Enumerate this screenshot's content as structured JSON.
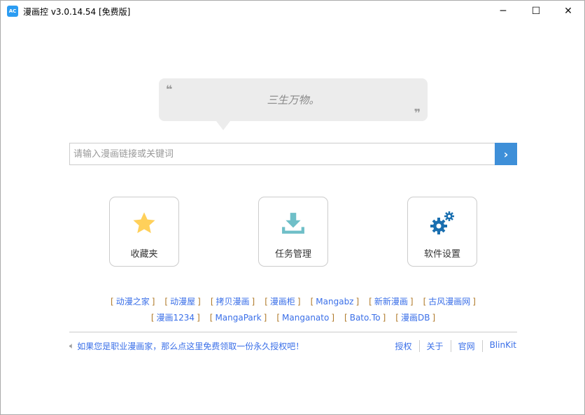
{
  "window": {
    "title": "漫画控 v3.0.14.54 [免费版]",
    "icon_text": "AC",
    "minimize": "─",
    "maximize": "☐",
    "close": "✕"
  },
  "quote": {
    "open": "❝",
    "text": "三生万物。",
    "close": "❞"
  },
  "search": {
    "placeholder": "请输入漫画链接或关键词",
    "value": "",
    "go": "›"
  },
  "cards": [
    {
      "label": "收藏夹",
      "icon": "star-icon",
      "color": "#ffd05a"
    },
    {
      "label": "任务管理",
      "icon": "download-icon",
      "color": "#6fbfc8"
    },
    {
      "label": "软件设置",
      "icon": "gears-icon",
      "color": "#1a6fb0"
    }
  ],
  "sites_row1": [
    "动漫之家",
    "动漫屋",
    "拷贝漫画",
    "漫画柜",
    "Mangabz",
    "新新漫画",
    "古风漫画网"
  ],
  "sites_row2": [
    "漫画1234",
    "MangaPark",
    "Manganato",
    "Bato.To",
    "漫画DB"
  ],
  "bracket_open": "[",
  "bracket_close": "]",
  "notice": "如果您是职业漫画家，那么点这里免费领取一份永久授权吧！",
  "footer_links": [
    "授权",
    "关于",
    "官网",
    "BlinKit"
  ]
}
